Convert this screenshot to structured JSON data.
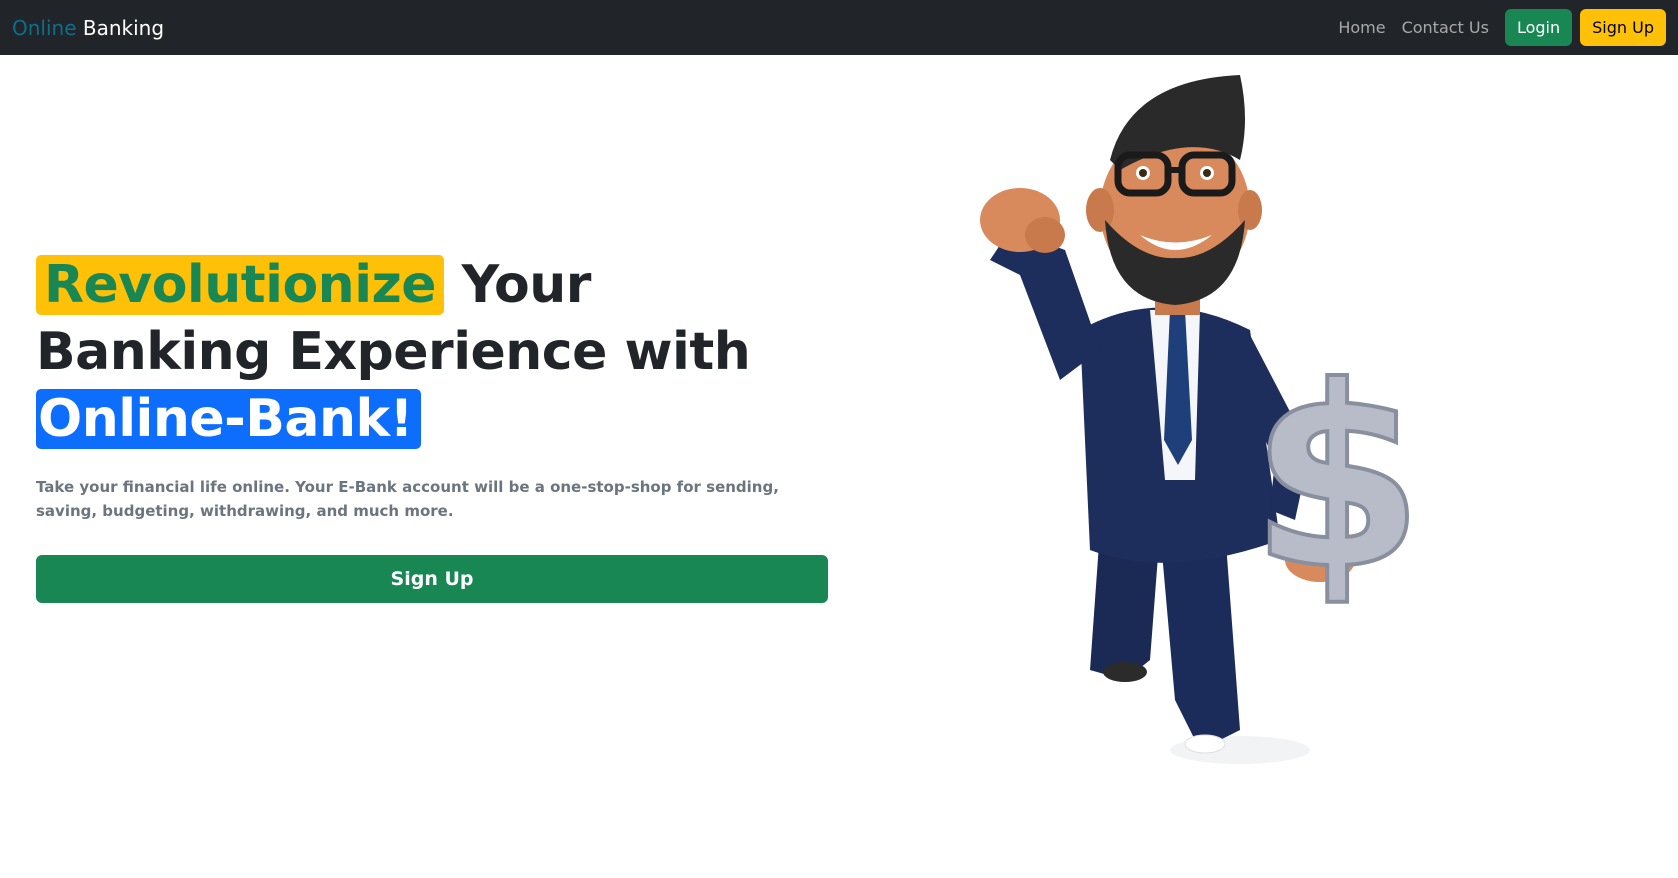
{
  "navbar": {
    "brand_part1": "Online",
    "brand_part2": "Banking",
    "links": [
      {
        "label": "Home"
      },
      {
        "label": "Contact Us"
      }
    ],
    "login_label": "Login",
    "signup_label": "Sign Up"
  },
  "hero": {
    "headline_highlight1": "Revolutionize",
    "headline_mid": " Your Banking Experience with ",
    "headline_highlight2": "Online-Bank!",
    "lead": "Take your financial life online. Your E-Bank account will be a one-stop-shop for sending, saving, budgeting, withdrawing, and much more.",
    "cta_label": "Sign Up"
  },
  "colors": {
    "navbar_bg": "#212529",
    "success": "#198754",
    "warning": "#ffc107",
    "primary": "#0d6efd"
  },
  "icons": {
    "illustration": "businessman-dollar-illustration"
  }
}
